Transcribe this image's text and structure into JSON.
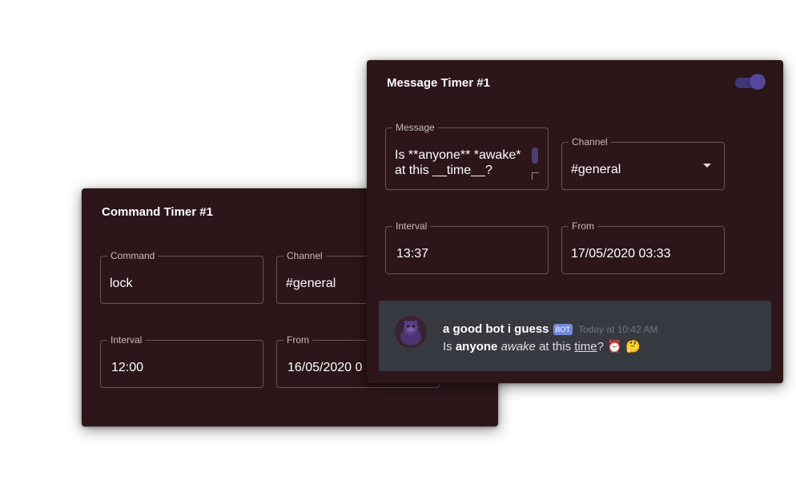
{
  "command_timer": {
    "title": "Command Timer #1",
    "command": {
      "label": "Command",
      "value": "lock"
    },
    "channel": {
      "label": "Channel",
      "value": "#general"
    },
    "interval": {
      "label": "Interval",
      "value": "12:00"
    },
    "from": {
      "label": "From",
      "value": "16/05/2020 0"
    }
  },
  "message_timer": {
    "title": "Message Timer #1",
    "enabled": true,
    "message": {
      "label": "Message",
      "line1": "Is **anyone** *awake*",
      "line2": "at this __time__?"
    },
    "channel": {
      "label": "Channel",
      "value": "#general"
    },
    "interval": {
      "label": "Interval",
      "value": "13:37"
    },
    "from": {
      "label": "From",
      "value": "17/05/2020 03:33"
    },
    "preview": {
      "author": "a good bot i guess",
      "bot_tag": "BOT",
      "timestamp": "Today at 10:42 AM",
      "text_is": "Is",
      "text_anyone": "anyone",
      "text_awake": "awake",
      "text_at_this": "at this",
      "text_time": "time",
      "text_q": "?",
      "emoji_1": "⏰",
      "emoji_2": "🤔"
    }
  },
  "colors": {
    "card_background": "#2c1619",
    "toggle_accent": "#55489a",
    "preview_background": "#36393f",
    "bot_tag": "#7289da"
  }
}
